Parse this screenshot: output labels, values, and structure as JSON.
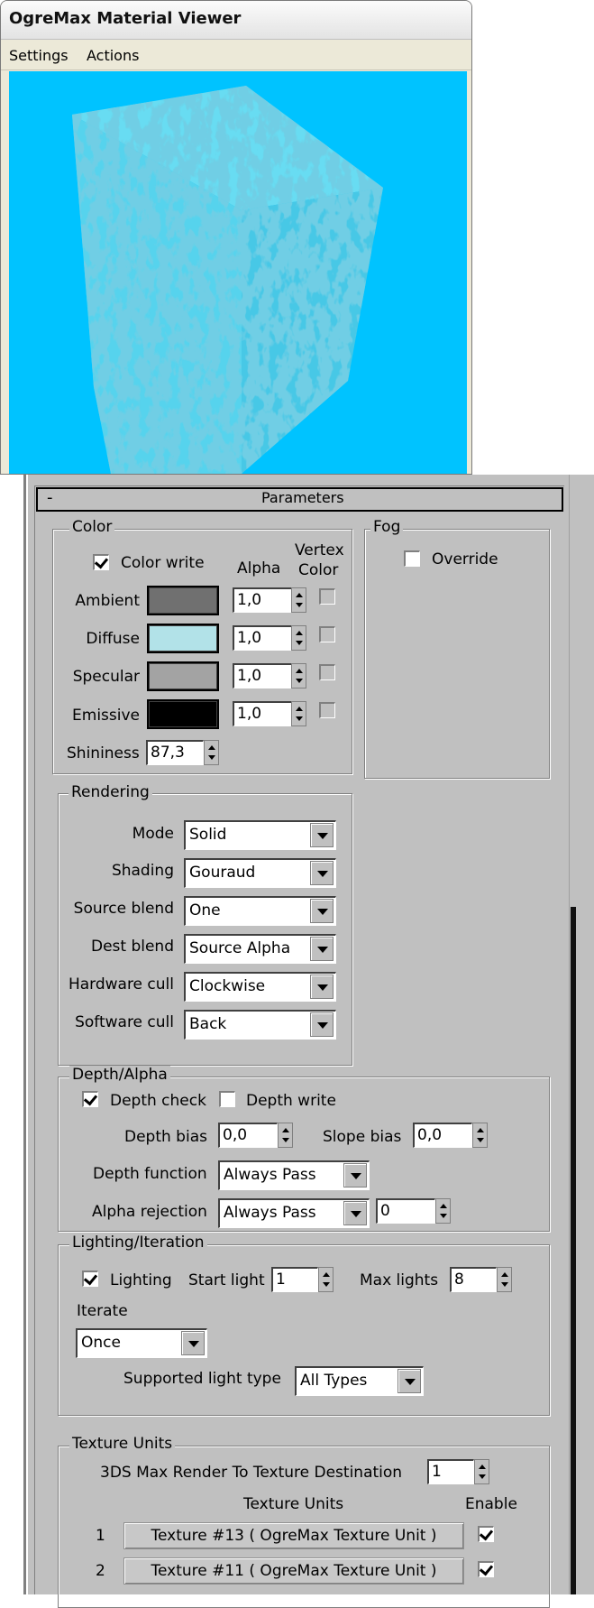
{
  "viewer": {
    "title": "OgreMax Material Viewer",
    "menu": [
      "Settings",
      "Actions"
    ],
    "background_color": "#00c3ff",
    "cube_color": "#4fd3ef"
  },
  "rollout": {
    "collapse_symbol": "-",
    "title": "Parameters"
  },
  "color": {
    "group_label": "Color",
    "color_write_label": "Color write",
    "color_write": true,
    "alpha_header": "Alpha",
    "vertex_header_1": "Vertex",
    "vertex_header_2": "Color",
    "rows": [
      {
        "label": "Ambient",
        "swatch": "#707070",
        "alpha": "1,0"
      },
      {
        "label": "Diffuse",
        "swatch": "#b2e2e8",
        "alpha": "1,0"
      },
      {
        "label": "Specular",
        "swatch": "#a3a3a3",
        "alpha": "1,0"
      },
      {
        "label": "Emissive",
        "swatch": "#000000",
        "alpha": "1,0"
      }
    ],
    "shininess_label": "Shininess",
    "shininess": "87,3"
  },
  "fog": {
    "group_label": "Fog",
    "override_label": "Override",
    "override": false
  },
  "rendering": {
    "group_label": "Rendering",
    "rows": [
      {
        "label": "Mode",
        "value": "Solid"
      },
      {
        "label": "Shading",
        "value": "Gouraud"
      },
      {
        "label": "Source blend",
        "value": "One"
      },
      {
        "label": "Dest blend",
        "value": "Source Alpha"
      },
      {
        "label": "Hardware cull",
        "value": "Clockwise"
      },
      {
        "label": "Software cull",
        "value": "Back"
      }
    ]
  },
  "depth": {
    "group_label": "Depth/Alpha",
    "depth_check_label": "Depth check",
    "depth_check": true,
    "depth_write_label": "Depth write",
    "depth_write": false,
    "depth_bias_label": "Depth bias",
    "depth_bias": "0,0",
    "slope_bias_label": "Slope bias",
    "slope_bias": "0,0",
    "depth_function_label": "Depth function",
    "depth_function": "Always Pass",
    "alpha_rejection_label": "Alpha rejection",
    "alpha_rejection": "Always Pass",
    "alpha_rejection_value": "0"
  },
  "lighting": {
    "group_label": "Lighting/Iteration",
    "lighting_label": "Lighting",
    "lighting": true,
    "start_light_label": "Start light",
    "start_light": "1",
    "max_lights_label": "Max lights",
    "max_lights": "8",
    "iterate_label": "Iterate",
    "iterate": "Once",
    "supported_label": "Supported light type",
    "supported": "All Types"
  },
  "texture": {
    "group_label": "Texture Units",
    "rtt_label": "3DS Max Render To Texture  Destination",
    "rtt_destination": "1",
    "col_header": "Texture Units",
    "enable_header": "Enable",
    "units": [
      {
        "index": "1",
        "label": "Texture #13  ( OgreMax Texture Unit )",
        "enabled": true
      },
      {
        "index": "2",
        "label": "Texture #11  ( OgreMax Texture Unit )",
        "enabled": true
      }
    ]
  }
}
